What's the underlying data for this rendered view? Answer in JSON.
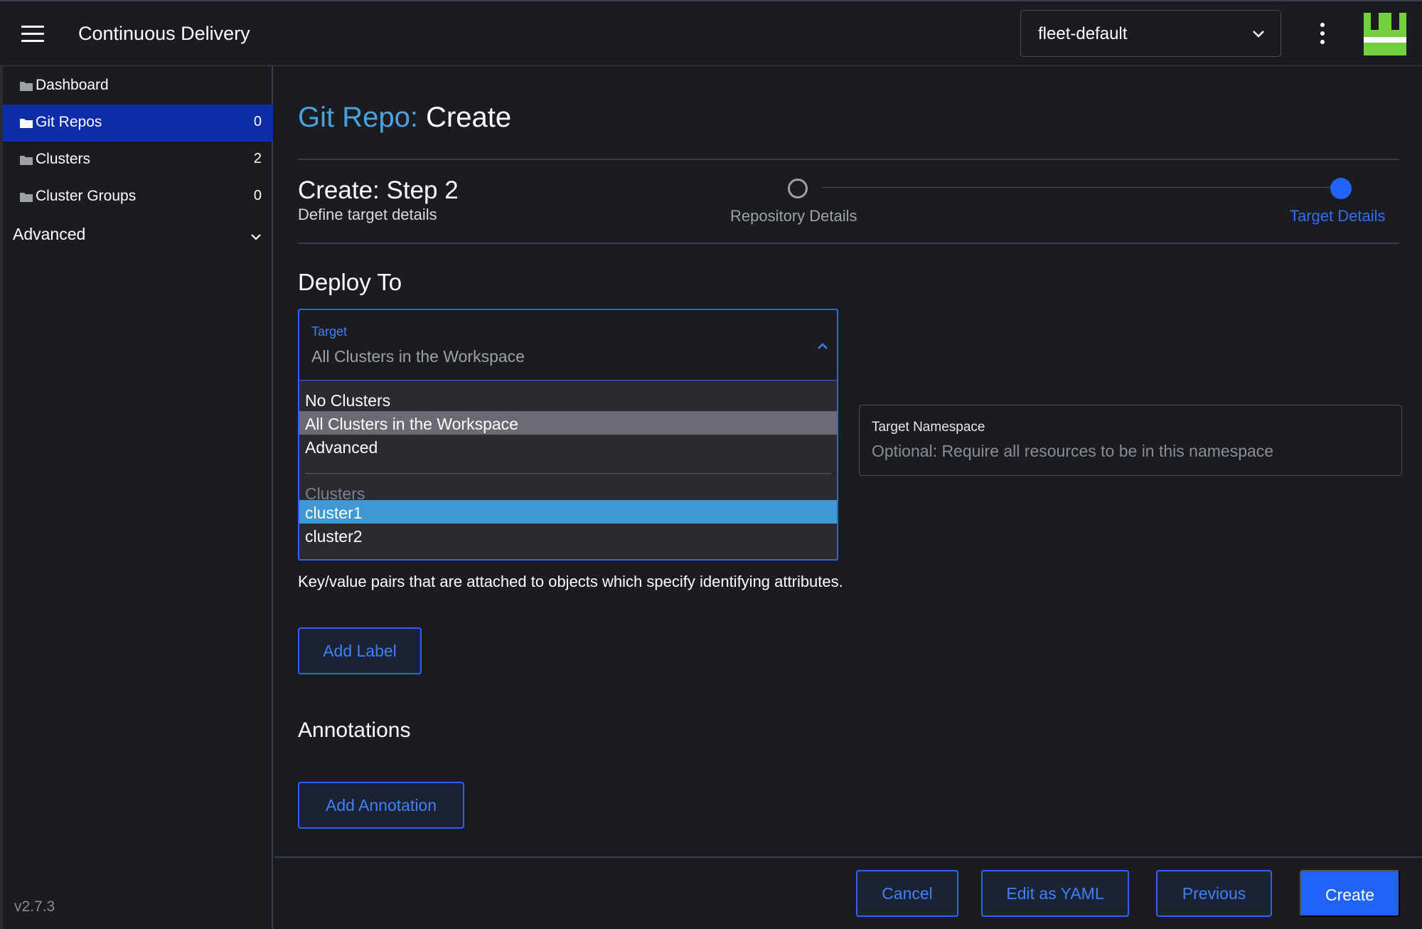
{
  "header": {
    "app_title": "Continuous Delivery",
    "workspace": "fleet-default",
    "menu_icon": "hamburger-menu-icon",
    "more_icon": "kebab-menu-icon",
    "logo_color": "#73d13d"
  },
  "sidebar": {
    "items": [
      {
        "label": "Dashboard",
        "count": "",
        "active": false
      },
      {
        "label": "Git Repos",
        "count": "0",
        "active": true
      },
      {
        "label": "Clusters",
        "count": "2",
        "active": false
      },
      {
        "label": "Cluster Groups",
        "count": "0",
        "active": false
      }
    ],
    "group_label": "Advanced",
    "version": "v2.7.3"
  },
  "main": {
    "title_crumb": "Git Repo:",
    "title_current": "Create",
    "step_title": "Create: Step 2",
    "step_subtitle": "Define target details",
    "wizard_steps": [
      "Repository Details",
      "Target Details"
    ],
    "deploy_to_title": "Deploy To",
    "target": {
      "label": "Target",
      "value": "All Clusters in the Workspace",
      "options": [
        "No Clusters",
        "All Clusters in the Workspace",
        "Advanced"
      ],
      "group_label": "Clusters",
      "cluster_options": [
        "cluster1",
        "cluster2"
      ]
    },
    "namespace": {
      "label": "Target Namespace",
      "placeholder": "Optional: Require all resources to be in this namespace"
    },
    "labels_description": "Key/value pairs that are attached to objects which specify identifying attributes.",
    "add_label": "Add Label",
    "annotations_title": "Annotations",
    "add_annotation": "Add Annotation"
  },
  "footer": {
    "cancel": "Cancel",
    "edit_yaml": "Edit as YAML",
    "previous": "Previous",
    "create": "Create"
  },
  "colors": {
    "accent": "#2163f6",
    "crumb": "#4aa3df",
    "active_nav": "#0d2ca8",
    "selected_option": "#3d98d3"
  }
}
